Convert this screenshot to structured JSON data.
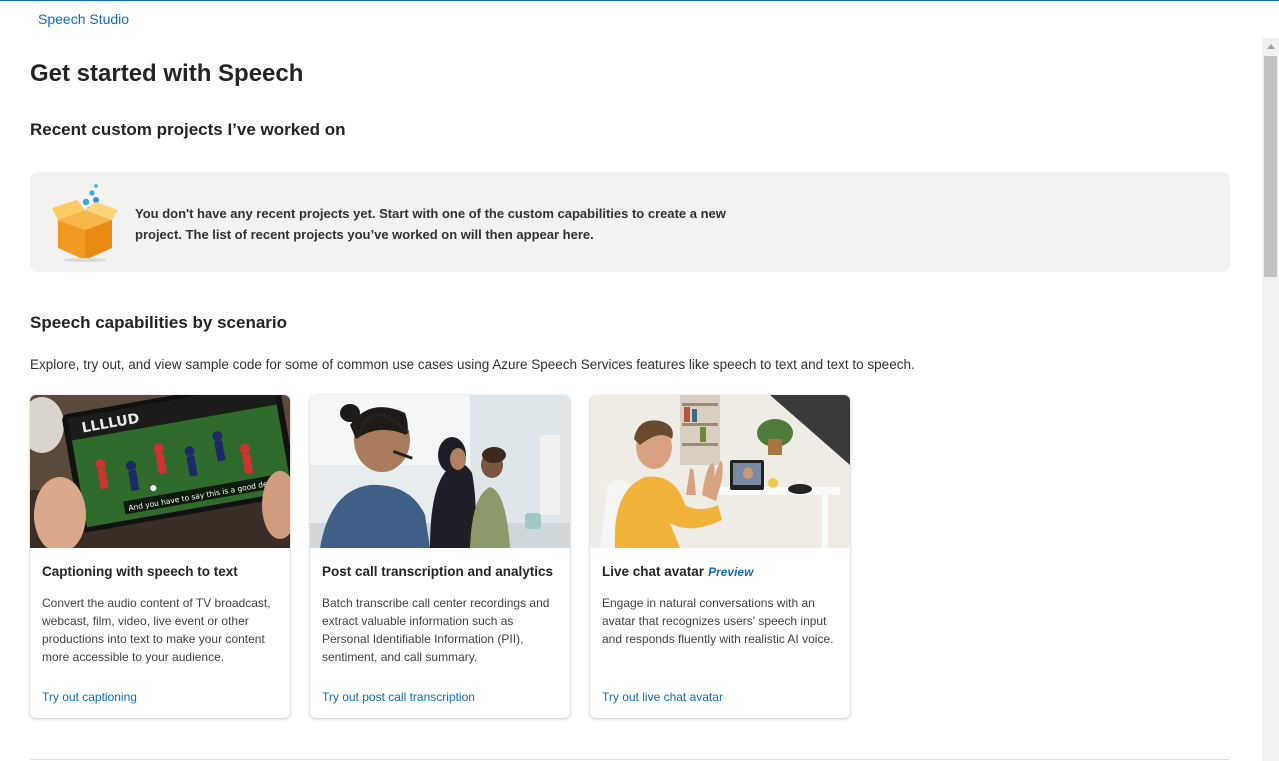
{
  "header": {
    "brand": "Speech Studio"
  },
  "page": {
    "title": "Get started with Speech"
  },
  "recent": {
    "title": "Recent custom projects I’ve worked on",
    "empty_message": "You don't have any recent projects yet. Start with one of the custom capabilities to create a new project. The list of recent projects you’ve worked on will then appear here."
  },
  "scenarios": {
    "title": "Speech capabilities by scenario",
    "description": "Explore, try out, and view sample code for some of common use cases using Azure Speech Services features like speech to text and text to speech.",
    "cards": [
      {
        "title": "Captioning with speech to text",
        "badge": "",
        "caption_overlay": "And you have to say this is a good defense.",
        "description": "Convert the audio content of TV broadcast, webcast, film, video, live event or other productions into text to make your content more accessible to your audience.",
        "link": "Try out captioning"
      },
      {
        "title": "Post call transcription and analytics",
        "badge": "",
        "description": "Batch transcribe call center recordings and extract valuable information such as Personal Identifiable Information (PII), sentiment, and call summary.",
        "link": "Try out post call transcription"
      },
      {
        "title": "Live chat avatar",
        "badge": "Preview",
        "description": "Engage in natural conversations with an avatar that recognizes users' speech input and responds fluently with realistic AI voice.",
        "link": "Try out live chat avatar"
      }
    ]
  },
  "colors": {
    "accent": "#0f6cbd",
    "panel": "#f3f2f1"
  }
}
